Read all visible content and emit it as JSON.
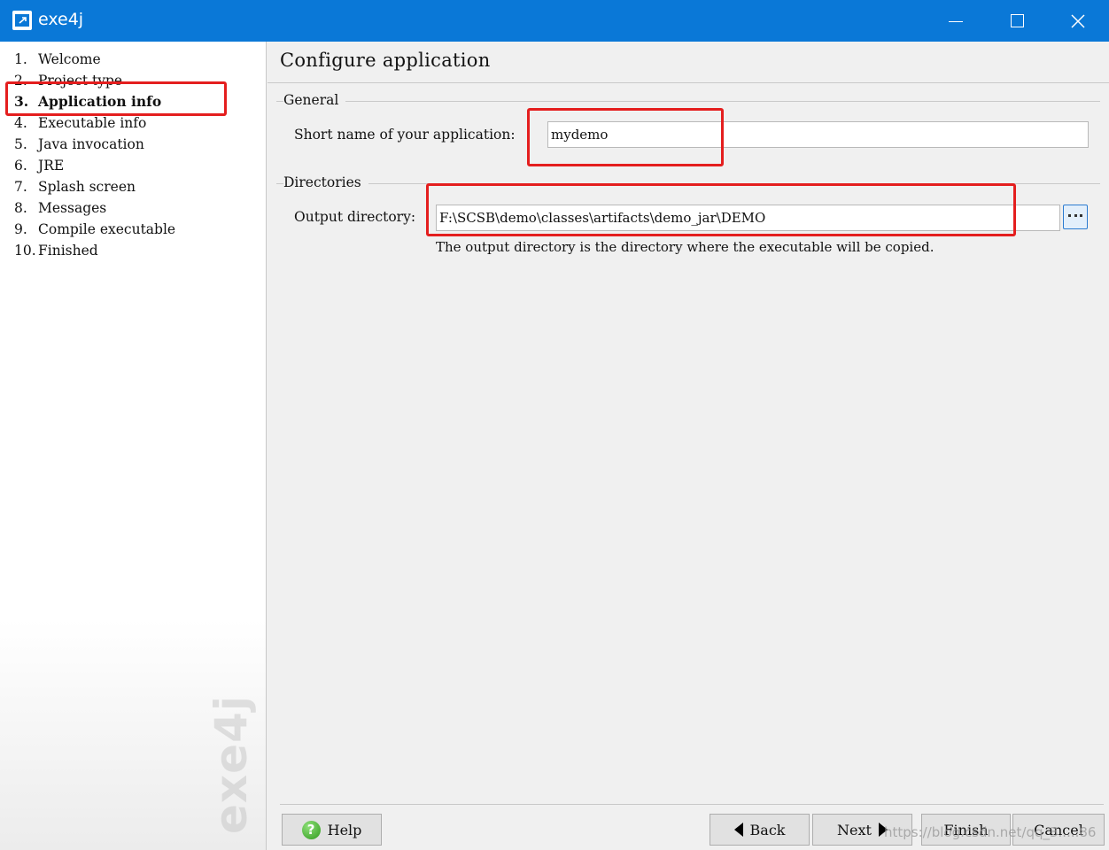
{
  "window": {
    "title": "exe4j",
    "title_bar_color": "#0a78d7",
    "controls": [
      "minimize-icon",
      "maximize-icon",
      "close-icon"
    ]
  },
  "sidebar": {
    "steps": [
      {
        "num": "1.",
        "label": "Welcome",
        "active": false
      },
      {
        "num": "2.",
        "label": "Project type",
        "active": false
      },
      {
        "num": "3.",
        "label": "Application info",
        "active": true
      },
      {
        "num": "4.",
        "label": "Executable info",
        "active": false
      },
      {
        "num": "5.",
        "label": "Java invocation",
        "active": false
      },
      {
        "num": "6.",
        "label": "JRE",
        "active": false
      },
      {
        "num": "7.",
        "label": "Splash screen",
        "active": false
      },
      {
        "num": "8.",
        "label": "Messages",
        "active": false
      },
      {
        "num": "9.",
        "label": "Compile executable",
        "active": false
      },
      {
        "num": "10.",
        "label": "Finished",
        "active": false
      }
    ],
    "brand_watermark": "exe4j"
  },
  "main": {
    "title": "Configure application",
    "general": {
      "label": "General",
      "short_name_label": "Short name of your application:",
      "short_name_value": "mydemo"
    },
    "directories": {
      "label": "Directories",
      "output_label": "Output directory:",
      "output_value": "F:\\SCSB\\demo\\classes\\artifacts\\demo_jar\\DEMO",
      "browse_icon": "ellipsis-icon",
      "hint": "The output directory is the directory where the executable will be copied."
    }
  },
  "footer": {
    "help": "Help",
    "back": "Back",
    "next": "Next",
    "finish": "Finish",
    "cancel": "Cancel"
  },
  "annotation_color": "#e41e1e",
  "image_watermark": "https://blog.csdn.net/qq_3.....86"
}
